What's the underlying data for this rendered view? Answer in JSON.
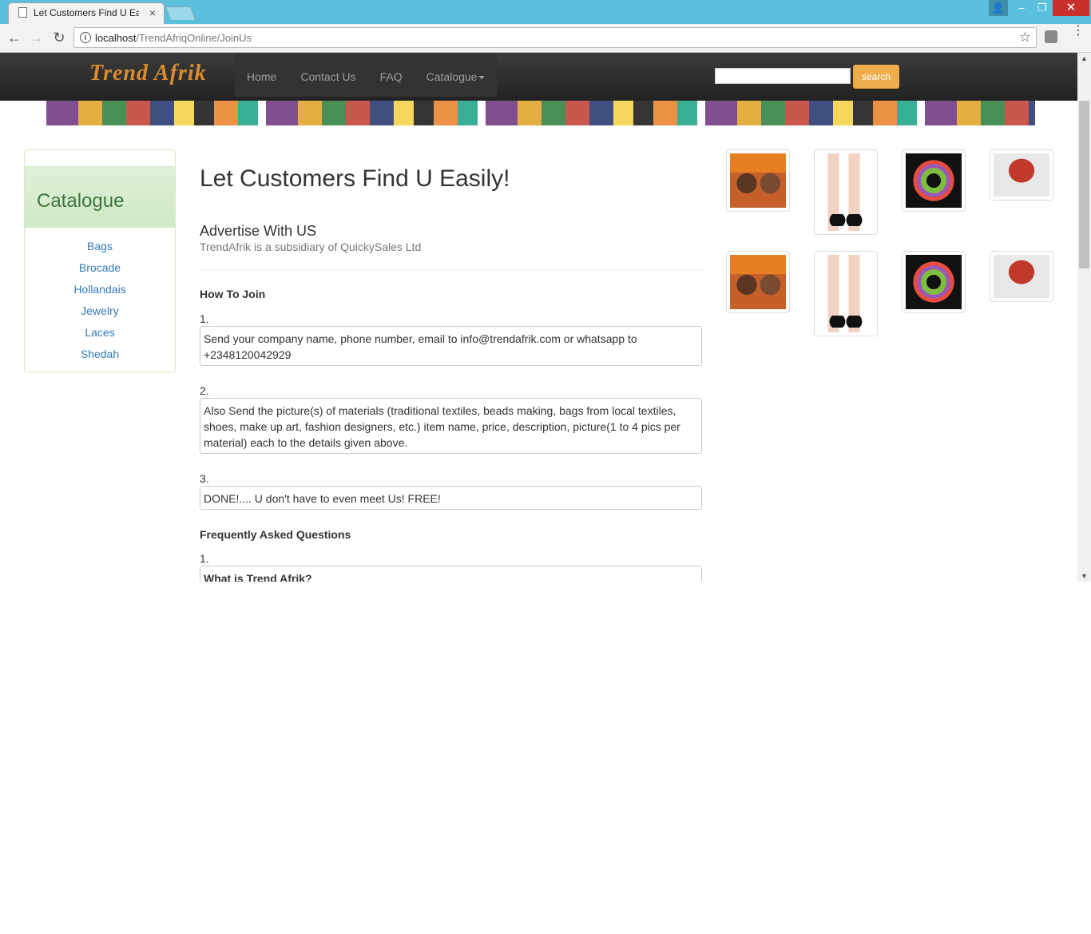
{
  "browser": {
    "tab_title": "Let Customers Find U Ea:",
    "tab_close": "×",
    "url_host": "localhost",
    "url_path": "/TrendAfriqOnline/JoinUs",
    "icons": [
      "page-icon",
      "back-arrow-icon",
      "forward-arrow-icon",
      "reload-icon",
      "info-icon",
      "star-icon",
      "extension-icon",
      "menu-icon",
      "user-icon",
      "minimize-icon",
      "maximize-icon",
      "close-icon"
    ],
    "win_min": "–",
    "win_max": "❐",
    "win_close": "✕",
    "back": "←",
    "forward": "→",
    "reload": "↻",
    "info": "i",
    "star": "☆",
    "menu": "⋮",
    "user": "👤"
  },
  "navbar": {
    "brand": "Trend Afrik",
    "links": [
      "Home",
      "Contact Us",
      "FAQ",
      "Catalogue"
    ],
    "search_value": "",
    "search_button": "search",
    "accent_color": "#f0ad4e"
  },
  "sidebar": {
    "title": "Catalogue",
    "items": [
      "Bags",
      "Brocade",
      "Hollandais",
      "Jewelry",
      "Laces",
      "Shedah"
    ]
  },
  "main": {
    "title": "Let Customers Find U Easily!",
    "advertise_title": "Advertise With US",
    "advertise_subtitle": "TrendAfrik is a subsidiary of QuickySales Ltd",
    "how_to_join_title": "How To Join",
    "steps": [
      {
        "num": "1.",
        "text": "Send your company name, phone number, email to info@trendafrik.com or whatsapp to +2348120042929"
      },
      {
        "num": "2.",
        "text": "Also Send the picture(s) of materials (traditional textiles, beads making, bags from local textiles, shoes, make up art, fashion designers, etc.) item name, price, description, picture(1 to 4 pics per material) each to the details given above."
      },
      {
        "num": "3.",
        "text": "DONE!.... U don't have to even meet Us! FREE!"
      }
    ],
    "faq_title": "Frequently Asked Questions",
    "faq": [
      {
        "num": "1.",
        "question": "What is Trend Afrik?"
      }
    ]
  },
  "thumbnails": [
    "two-women-headwrap",
    "black-heels",
    "beaded-necklace",
    "red-coral-necklace",
    "two-women-headwrap",
    "black-heels",
    "beaded-necklace",
    "red-coral-necklace"
  ]
}
